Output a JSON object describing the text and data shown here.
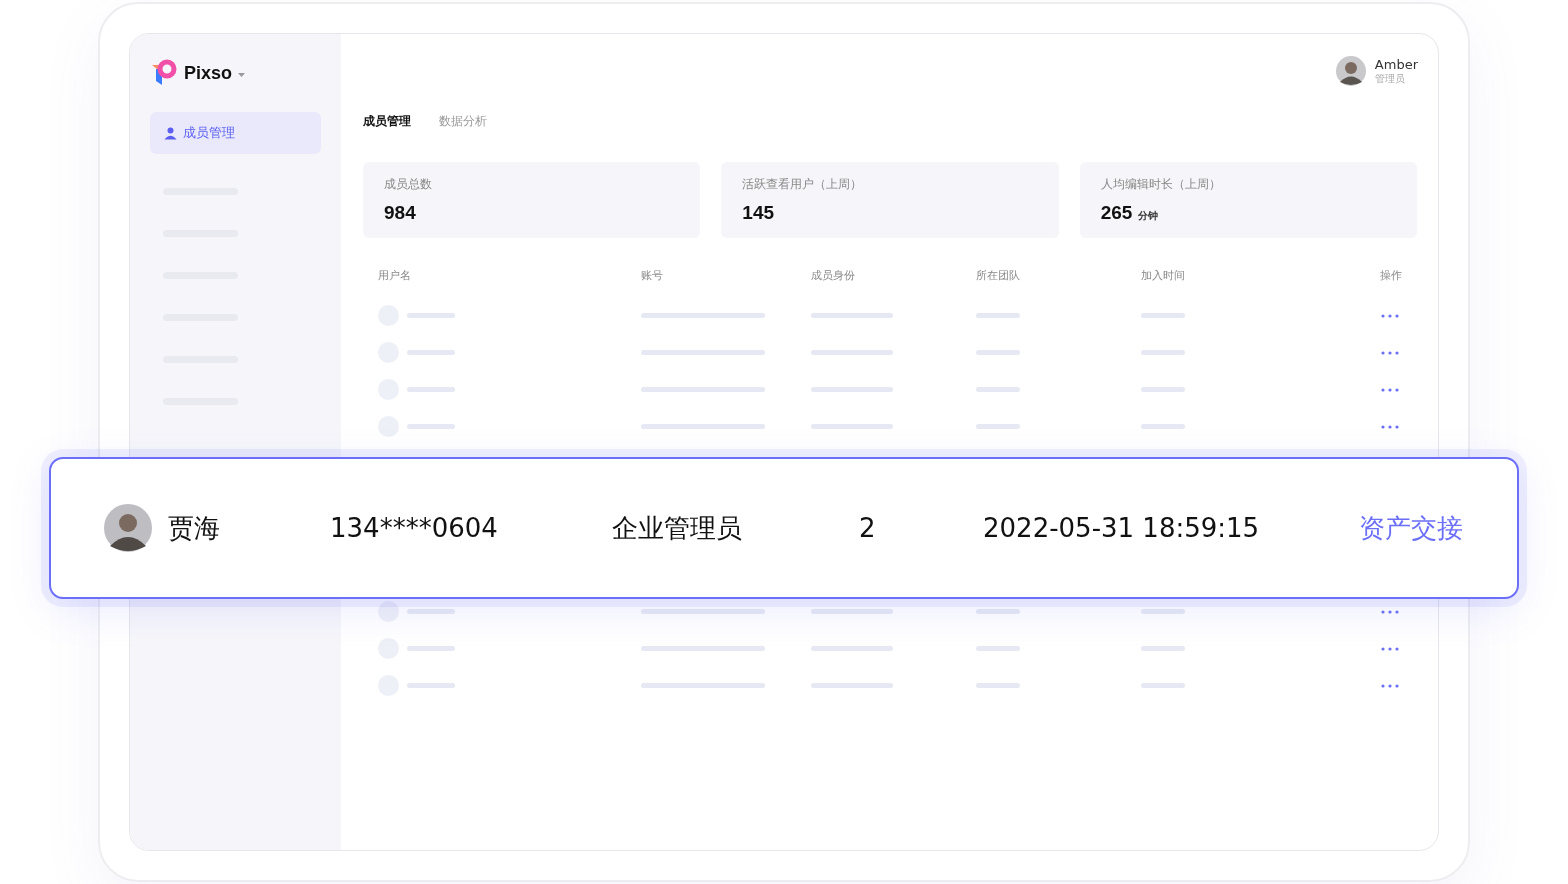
{
  "app": {
    "brand": "Pixso",
    "nav": [
      {
        "label": "成员管理",
        "selected": true
      }
    ],
    "user": {
      "name": "Amber",
      "role": "管理员"
    }
  },
  "tabs": [
    {
      "label": "成员管理",
      "selected": true
    },
    {
      "label": "数据分析",
      "selected": false
    }
  ],
  "stats": [
    {
      "label": "成员总数",
      "value": "984"
    },
    {
      "label": "活跃查看用户（上周）",
      "value": "145"
    },
    {
      "label": "人均编辑时长（上周）",
      "value": "265",
      "unit": "分钟"
    }
  ],
  "table": {
    "columns": [
      "用户名",
      "账号",
      "成员身份",
      "所在团队",
      "加入时间",
      "操作"
    ]
  },
  "highlight_row": {
    "name": "贾海",
    "account": "134****0604",
    "role": "企业管理员",
    "team": "2",
    "joined": "2022-05-31 18:59:15",
    "action": "资产交接"
  }
}
